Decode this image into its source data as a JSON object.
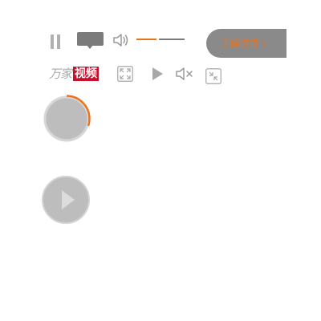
{
  "player": {
    "details_label": "了解详情 ›",
    "logo": {
      "brand_text": "万家",
      "box_text": "视频"
    },
    "volume_level_percent": 42,
    "loading_progress_percent": 30
  },
  "icons": {
    "pause": "pause-icon",
    "comment": "comment-bubble-icon",
    "volume": "volume-icon",
    "fullscreen": "fullscreen-icon",
    "play": "play-icon",
    "mute": "mute-icon",
    "exit_fullscreen": "exit-fullscreen-icon"
  },
  "colors": {
    "accent": "#e9741f",
    "icon_gray": "#b0b0b0",
    "button_gray": "#8a8a8a",
    "logo_red": "#c8102e"
  }
}
